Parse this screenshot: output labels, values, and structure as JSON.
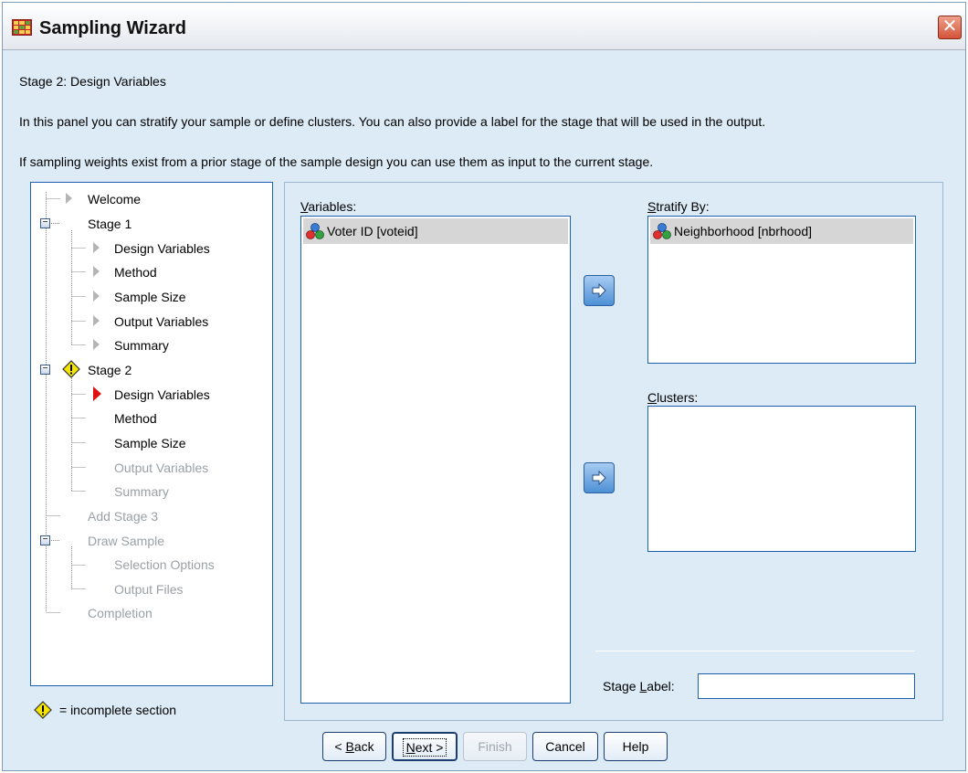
{
  "window": {
    "title": "Sampling Wizard",
    "close_glyph": "✕"
  },
  "header": {
    "stage_title": "Stage 2: Design Variables",
    "description_1": "In this panel you can stratify your sample or define clusters. You can also provide a label for the stage that will be used in the output.",
    "description_2": "If sampling weights exist from a prior stage of the sample design you can use them as input to the current stage."
  },
  "nav": {
    "items": [
      {
        "label": "Welcome",
        "state": "normal"
      },
      {
        "label": "Stage 1",
        "state": "normal"
      },
      {
        "label": "Design Variables",
        "state": "normal"
      },
      {
        "label": "Method",
        "state": "normal"
      },
      {
        "label": "Sample Size",
        "state": "normal"
      },
      {
        "label": "Output Variables",
        "state": "normal"
      },
      {
        "label": "Summary",
        "state": "normal"
      },
      {
        "label": "Stage 2",
        "state": "incomplete"
      },
      {
        "label": "Design Variables",
        "state": "current"
      },
      {
        "label": "Method",
        "state": "normal"
      },
      {
        "label": "Sample Size",
        "state": "normal"
      },
      {
        "label": "Output Variables",
        "state": "disabled"
      },
      {
        "label": "Summary",
        "state": "disabled"
      },
      {
        "label": "Add Stage 3",
        "state": "disabled"
      },
      {
        "label": "Draw Sample",
        "state": "disabled"
      },
      {
        "label": "Selection Options",
        "state": "disabled"
      },
      {
        "label": "Output Files",
        "state": "disabled"
      },
      {
        "label": "Completion",
        "state": "disabled"
      }
    ],
    "legend": "= incomplete section"
  },
  "variables": {
    "label_pre": "",
    "label_key": "V",
    "label_post": "ariables:",
    "items": [
      "Voter ID [voteid]"
    ]
  },
  "stratify": {
    "label_key": "S",
    "label_post": "tratify By:",
    "items": [
      "Neighborhood [nbrhood]"
    ]
  },
  "clusters": {
    "label_key": "C",
    "label_post": "lusters:",
    "items": []
  },
  "stage_label": {
    "label_pre": "Stage ",
    "label_key": "L",
    "label_post": "abel:",
    "value": ""
  },
  "buttons": {
    "back": {
      "pre": "< ",
      "key": "B",
      "post": "ack"
    },
    "next": {
      "key": "N",
      "post": "ext >"
    },
    "finish": "Finish",
    "cancel": "Cancel",
    "help": "Help"
  },
  "colors": {
    "dialog_bg": "#dcebf6",
    "list_border": "#1f5fb0",
    "current_marker": "#e01010",
    "warning": "#f5e400"
  }
}
